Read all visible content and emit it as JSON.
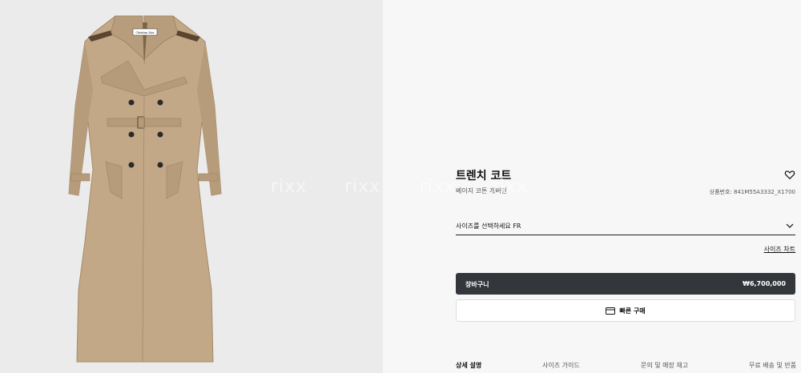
{
  "product": {
    "title": "트렌치 코트",
    "subtitle": "베이지 코튼 개버딘",
    "sku": "상품번호: 841M55A3332_X1700",
    "label_text": "Christian Dior"
  },
  "size_selector": {
    "label": "사이즈를 선택하세요 FR"
  },
  "size_chart_link": "사이즈 차트",
  "cart": {
    "label": "장바구니",
    "price": "₩6,700,000"
  },
  "quick_buy": {
    "label": "빠른 구매"
  },
  "tabs": [
    "상세 설명",
    "사이즈 가이드",
    "문의 및 매장 재고",
    "무료 배송 및 반품"
  ],
  "watermark": [
    "rixx",
    "rixx",
    "rixx",
    "rixx"
  ],
  "colors": {
    "coat": "#c2a887",
    "button_dark": "#33373b",
    "image_bg": "#ebebeb",
    "panel_bg": "#f7f7f7"
  },
  "icons": {
    "wishlist": "heart-outline-icon",
    "size_chevron": "chevron-down-icon",
    "quick_buy": "credit-card-icon"
  }
}
